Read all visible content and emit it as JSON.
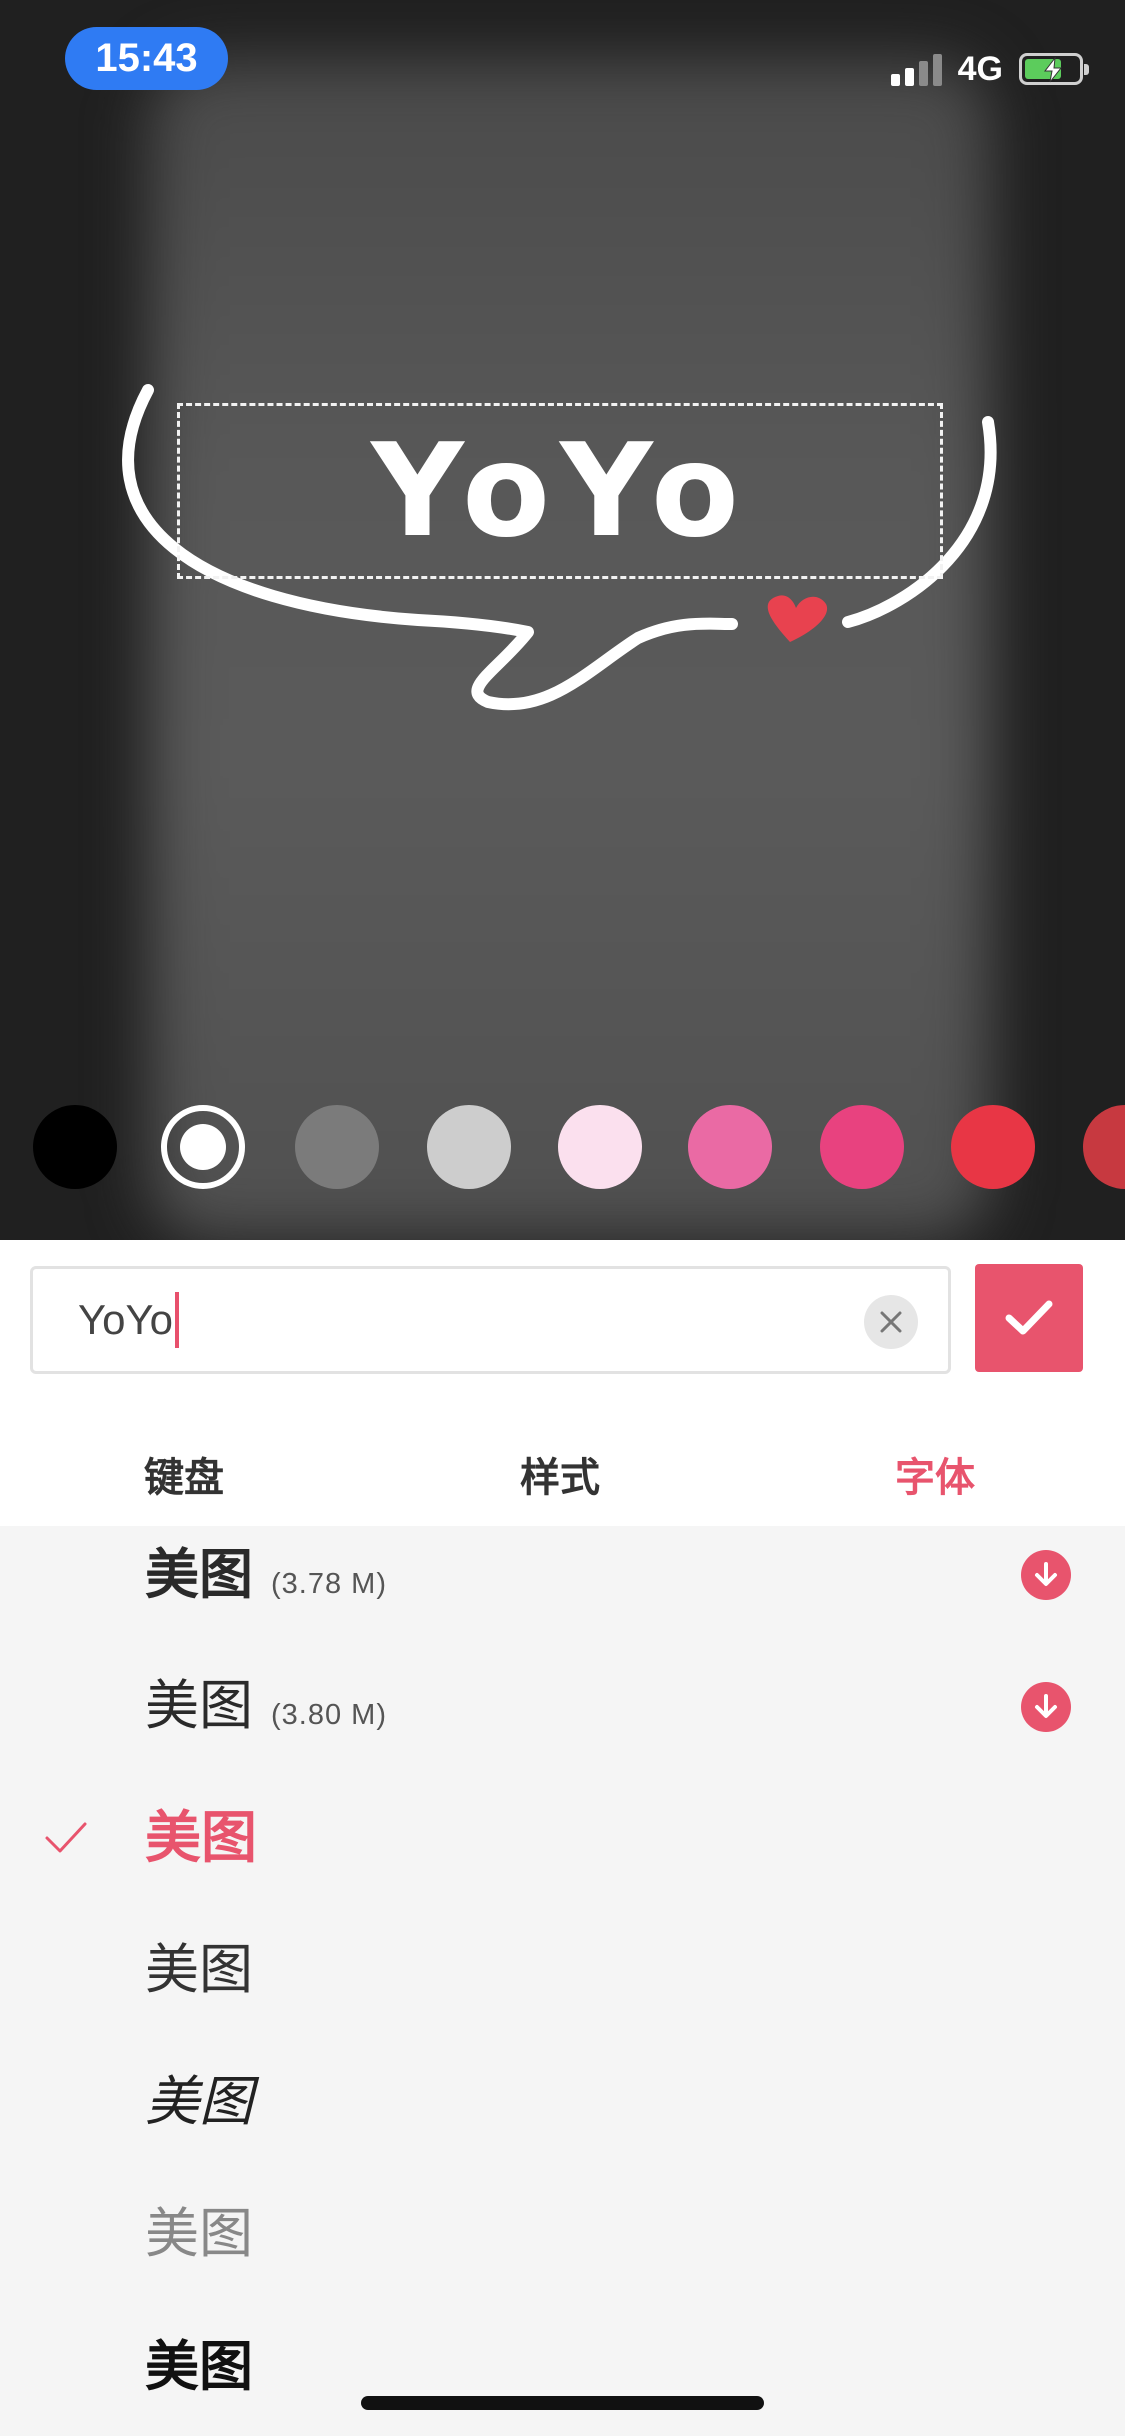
{
  "status": {
    "time": "15:43",
    "network": "4G"
  },
  "canvas": {
    "sticker_text": "YoYo"
  },
  "swatches": [
    {
      "name": "black",
      "color": "#000000"
    },
    {
      "name": "white",
      "color": "#ffffff",
      "selected": true
    },
    {
      "name": "gray",
      "color": "#7b7b7b"
    },
    {
      "name": "light-gray",
      "color": "#cdcdcd"
    },
    {
      "name": "light-pink",
      "color": "#fbe0ee"
    },
    {
      "name": "pink",
      "color": "#ea6aa4"
    },
    {
      "name": "hot-pink",
      "color": "#e8427f"
    },
    {
      "name": "red",
      "color": "#e83645"
    },
    {
      "name": "dark-red",
      "color": "#c73940"
    }
  ],
  "editor": {
    "input_value": "YoYo",
    "confirm_icon": "check-icon",
    "clear_icon": "close-icon"
  },
  "tabs": [
    {
      "label": "键盘",
      "active": false
    },
    {
      "label": "样式",
      "active": false
    },
    {
      "label": "字体",
      "active": true
    }
  ],
  "fonts": [
    {
      "sample": "美图",
      "size": "(3.78 M)",
      "download": true,
      "selected": false
    },
    {
      "sample": "美图",
      "size": "(3.80 M)",
      "download": true,
      "selected": false
    },
    {
      "sample": "美图",
      "size": "",
      "download": false,
      "selected": true
    },
    {
      "sample": "美图",
      "size": "",
      "download": false,
      "selected": false
    },
    {
      "sample": "美图",
      "size": "",
      "download": false,
      "selected": false
    },
    {
      "sample": "美图",
      "size": "",
      "download": false,
      "selected": false
    },
    {
      "sample": "美图",
      "size": "",
      "download": false,
      "selected": false
    }
  ],
  "colors": {
    "accent": "#e8546d",
    "time_pill": "#2f7bf3"
  }
}
